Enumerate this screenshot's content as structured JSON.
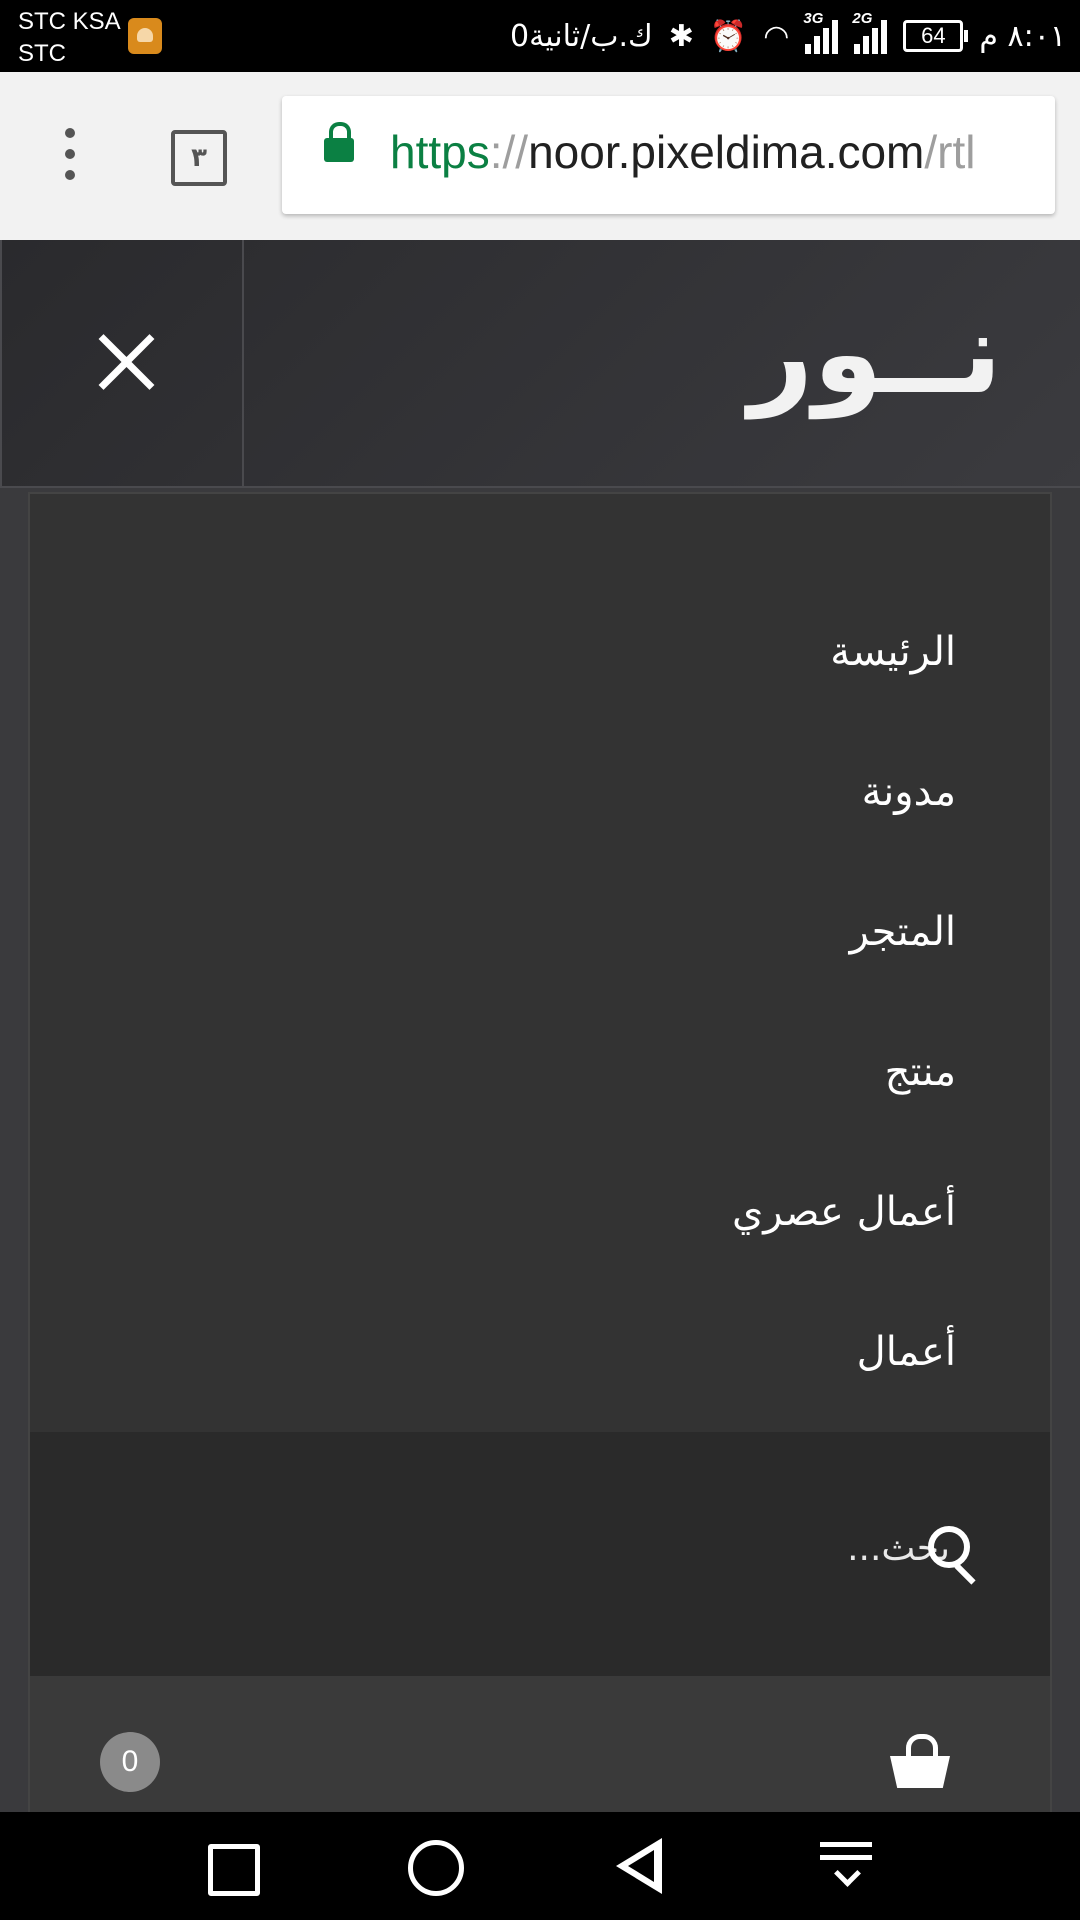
{
  "status_bar": {
    "carrier_line1": "STC KSA",
    "carrier_line2": "STC",
    "time": "٨:٠١ م",
    "battery": "64",
    "network_1": "2G",
    "network_2": "3G",
    "data_speed": "0ك.ب/ثانية"
  },
  "browser": {
    "url_scheme": "https",
    "url_sep": "://",
    "url_host": "noor.pixeldima.com",
    "url_path": "/rtl",
    "tab_count": "٣"
  },
  "site": {
    "logo": "نــور"
  },
  "menu": {
    "items": [
      {
        "label": "الرئيسة"
      },
      {
        "label": "مدونة"
      },
      {
        "label": "المتجر"
      },
      {
        "label": "منتج"
      },
      {
        "label": "أعمال عصري"
      },
      {
        "label": "أعمال"
      }
    ],
    "search_placeholder": "بحث...",
    "cart_count": "0"
  }
}
